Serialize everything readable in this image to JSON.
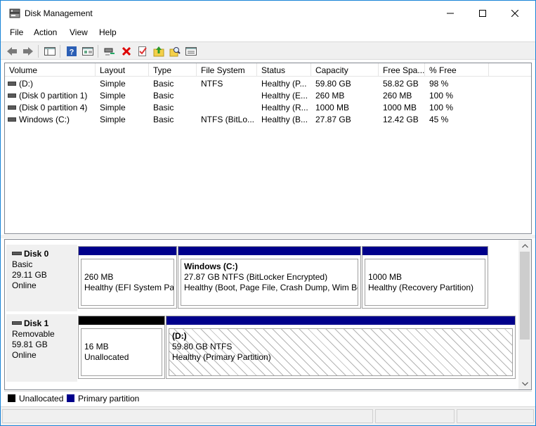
{
  "window": {
    "title": "Disk Management",
    "controls": {
      "minimize": "—",
      "maximize": "☐",
      "close": "✕"
    }
  },
  "menu": [
    "File",
    "Action",
    "View",
    "Help"
  ],
  "toolbar": [
    {
      "icon": "back-arrow-icon"
    },
    {
      "icon": "forward-arrow-icon"
    },
    {
      "icon": "show-hide-console-tree-icon"
    },
    {
      "icon": "help-icon"
    },
    {
      "icon": "properties-icon"
    },
    {
      "icon": "connect-virtual-disk-icon"
    },
    {
      "icon": "delete-icon"
    },
    {
      "icon": "check-icon"
    },
    {
      "icon": "folder-up-icon"
    },
    {
      "icon": "search-icon"
    },
    {
      "icon": "settings-list-icon"
    }
  ],
  "volume_list": {
    "columns": [
      "Volume",
      "Layout",
      "Type",
      "File System",
      "Status",
      "Capacity",
      "Free Spa...",
      "% Free"
    ],
    "rows": [
      {
        "volume": "(D:)",
        "layout": "Simple",
        "type": "Basic",
        "fs": "NTFS",
        "status": "Healthy (P...",
        "capacity": "59.80 GB",
        "free": "58.82 GB",
        "pct": "98 %"
      },
      {
        "volume": "(Disk 0 partition 1)",
        "layout": "Simple",
        "type": "Basic",
        "fs": "",
        "status": "Healthy (E...",
        "capacity": "260 MB",
        "free": "260 MB",
        "pct": "100 %"
      },
      {
        "volume": "(Disk 0 partition 4)",
        "layout": "Simple",
        "type": "Basic",
        "fs": "",
        "status": "Healthy (R...",
        "capacity": "1000 MB",
        "free": "1000 MB",
        "pct": "100 %"
      },
      {
        "volume": "Windows (C:)",
        "layout": "Simple",
        "type": "Basic",
        "fs": "NTFS (BitLo...",
        "status": "Healthy (B...",
        "capacity": "27.87 GB",
        "free": "12.42 GB",
        "pct": "45 %"
      }
    ]
  },
  "disks": [
    {
      "name": "Disk 0",
      "kind": "Basic",
      "size": "29.11 GB",
      "state": "Online",
      "partitions": [
        {
          "title": "",
          "line1": "260 MB",
          "line2": "Healthy (EFI System Part",
          "bar": "primary"
        },
        {
          "title": "Windows  (C:)",
          "line1": "27.87 GB NTFS (BitLocker Encrypted)",
          "line2": "Healthy (Boot, Page File, Crash Dump, Wim Bo",
          "bar": "primary"
        },
        {
          "title": "",
          "line1": "1000 MB",
          "line2": "Healthy (Recovery Partition)",
          "bar": "primary"
        }
      ]
    },
    {
      "name": "Disk 1",
      "kind": "Removable",
      "size": "59.81 GB",
      "state": "Online",
      "partitions": [
        {
          "title": "",
          "line1": "16 MB",
          "line2": "Unallocated",
          "bar": "unallocated"
        },
        {
          "title": "(D:)",
          "line1": "59.80 GB NTFS",
          "line2": "Healthy (Primary Partition)",
          "bar": "primary"
        }
      ]
    }
  ],
  "legend": [
    {
      "label": "Unallocated",
      "color": "#000000"
    },
    {
      "label": "Primary partition",
      "color": "#00008b"
    }
  ],
  "colors": {
    "accent_border": "#1883d7",
    "primary_partition": "#00008b",
    "unallocated": "#000000"
  }
}
